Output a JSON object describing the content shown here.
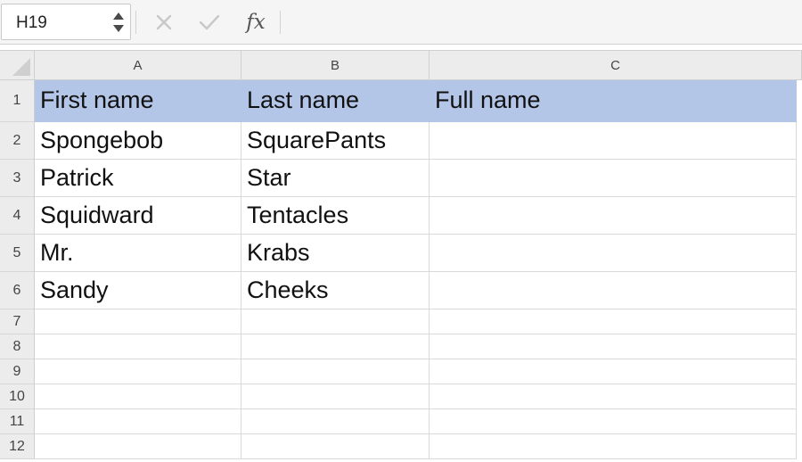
{
  "formula_bar": {
    "name_box": "H19",
    "fx_label": "fx",
    "formula": ""
  },
  "columns": [
    "A",
    "B",
    "C"
  ],
  "rows": [
    {
      "num": "1",
      "cells": [
        "First name",
        "Last name",
        "Full name"
      ]
    },
    {
      "num": "2",
      "cells": [
        "Spongebob",
        "SquarePants",
        ""
      ]
    },
    {
      "num": "3",
      "cells": [
        "Patrick",
        "Star",
        ""
      ]
    },
    {
      "num": "4",
      "cells": [
        "Squidward",
        "Tentacles",
        ""
      ]
    },
    {
      "num": "5",
      "cells": [
        "Mr.",
        "Krabs",
        ""
      ]
    },
    {
      "num": "6",
      "cells": [
        "Sandy",
        "Cheeks",
        ""
      ]
    },
    {
      "num": "7",
      "cells": [
        "",
        "",
        ""
      ]
    },
    {
      "num": "8",
      "cells": [
        "",
        "",
        ""
      ]
    },
    {
      "num": "9",
      "cells": [
        "",
        "",
        ""
      ]
    },
    {
      "num": "10",
      "cells": [
        "",
        "",
        ""
      ]
    },
    {
      "num": "11",
      "cells": [
        "",
        "",
        ""
      ]
    },
    {
      "num": "12",
      "cells": [
        "",
        "",
        ""
      ]
    }
  ],
  "colors": {
    "header_row_fill": "#b4c6e7",
    "grid_header_bg": "#ececec"
  }
}
